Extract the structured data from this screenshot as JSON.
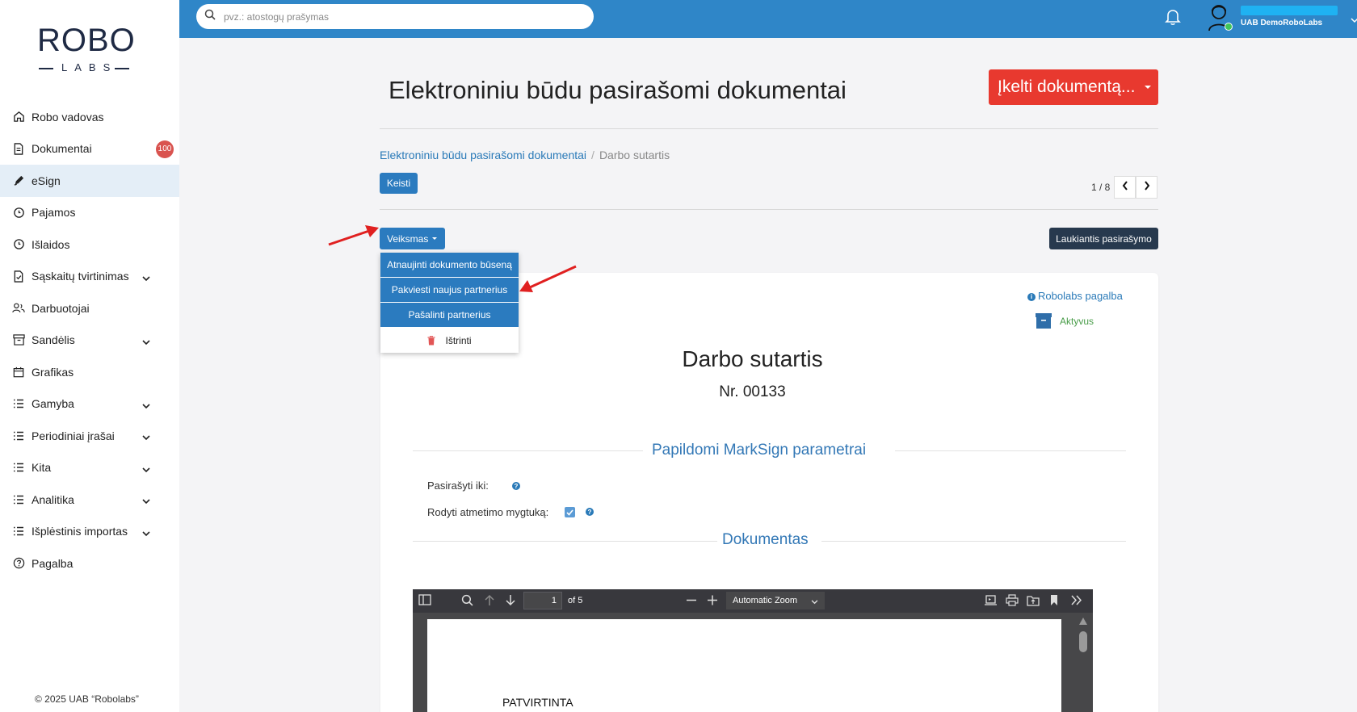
{
  "sidebar": {
    "logo_top": "ROBO",
    "logo_bottom": "LABS",
    "items": [
      {
        "label": "Robo vadovas"
      },
      {
        "label": "Dokumentai",
        "badge": "100"
      },
      {
        "label": "eSign"
      },
      {
        "label": "Pajamos"
      },
      {
        "label": "Išlaidos"
      },
      {
        "label": "Sąskaitų tvirtinimas"
      },
      {
        "label": "Darbuotojai"
      },
      {
        "label": "Sandėlis"
      },
      {
        "label": "Grafikas"
      },
      {
        "label": "Gamyba"
      },
      {
        "label": "Periodiniai įrašai"
      },
      {
        "label": "Kita"
      },
      {
        "label": "Analitika"
      },
      {
        "label": "Išplėstinis importas"
      },
      {
        "label": "Pagalba"
      }
    ],
    "copyright": "© 2025 UAB “Robolabs”"
  },
  "topbar": {
    "search_placeholder": "pvz.: atostogų prašymas",
    "user_name": "UAB DemoRoboLabs"
  },
  "main": {
    "title": "Elektroniniu būdu pasirašomi dokumentai",
    "upload_label": "Įkelti dokumentą...",
    "breadcrumb": {
      "parent": "Elektroniniu būdu pasirašomi dokumentai",
      "current": "Darbo sutartis"
    },
    "edit_label": "Keisti",
    "pager": "1 / 8",
    "action_label": "Veiksmas",
    "status_label": "Laukiantis pasirašymo",
    "dropdown": [
      "Atnaujinti dokumento būseną",
      "Pakviesti naujus partnerius",
      "Pašalinti partnerius",
      "Ištrinti"
    ]
  },
  "document": {
    "help_link": "Robolabs pagalba",
    "state": "Aktyvus",
    "title": "Darbo sutartis",
    "number": "Nr. 00133",
    "section_params": "Papildomi MarkSign parametrai",
    "sign_until_label": "Pasirašyti iki:",
    "show_reject_label": "Rodyti atmetimo mygtuką:",
    "show_reject_checked": true,
    "section_document": "Dokumentas"
  },
  "pdf_viewer": {
    "page_number": "1",
    "page_count_text": "of 5",
    "zoom": "Automatic Zoom",
    "page_text": "PATVIRTINTA"
  },
  "colors": {
    "topbar": "#2f86c8",
    "primary": "#2b7bbf",
    "danger": "#e8392f",
    "status_dark": "#27394e",
    "active_nav": "#e4eef7",
    "annotation_arrow": "#e02020"
  }
}
